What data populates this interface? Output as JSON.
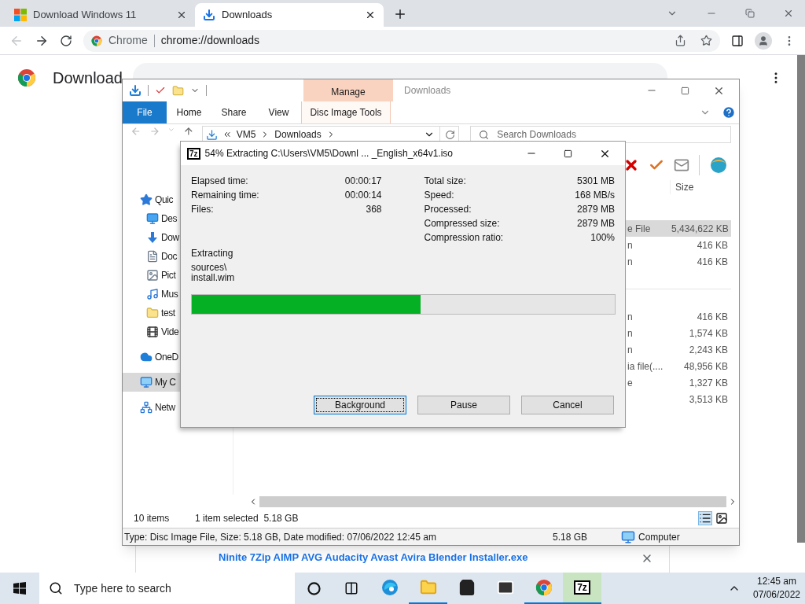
{
  "browser": {
    "tabs": [
      {
        "title": "Download Windows 11",
        "selected": false
      },
      {
        "title": "Downloads",
        "selected": true
      }
    ],
    "omnibox": {
      "site_label": "Chrome",
      "url": "chrome://downloads"
    },
    "page": {
      "title": "Download",
      "download": {
        "filename": "Ninite 7Zip AIMP AVG Audacity Avast Avira Blender Installer.exe"
      }
    }
  },
  "explorer": {
    "title": "Downloads",
    "contextual_header": "Manage",
    "ribbon_tabs": [
      {
        "label": "File",
        "kind": "file"
      },
      {
        "label": "Home",
        "kind": "tab"
      },
      {
        "label": "Share",
        "kind": "tab"
      },
      {
        "label": "View",
        "kind": "tab"
      },
      {
        "label": "Disc Image Tools",
        "kind": "contextual"
      }
    ],
    "breadcrumb": [
      "VM5",
      "Downloads"
    ],
    "search_placeholder": "Search Downloads",
    "column_header": "Size",
    "nav": [
      {
        "label": "Quic",
        "selected": false
      },
      {
        "label": "Des",
        "selected": false
      },
      {
        "label": "Dow",
        "selected": false
      },
      {
        "label": "Doc",
        "selected": false
      },
      {
        "label": "Pict",
        "selected": false
      },
      {
        "label": "Mus",
        "selected": false
      },
      {
        "label": "test",
        "selected": false
      },
      {
        "label": "Vide",
        "selected": false
      },
      {
        "label": "OneD",
        "selected": false
      },
      {
        "label": "My C",
        "selected": true
      },
      {
        "label": "Netw",
        "selected": false
      }
    ],
    "groups": [
      {
        "rows": [
          {
            "type": "e File",
            "size": "5,434,622 KB",
            "selected": true
          },
          {
            "type": "n",
            "size": "416 KB",
            "selected": false
          },
          {
            "type": "n",
            "size": "416 KB",
            "selected": false
          }
        ]
      },
      {
        "rows": [
          {
            "type": "n",
            "size": "416 KB",
            "selected": false
          },
          {
            "type": "n",
            "size": "1,574 KB",
            "selected": false
          },
          {
            "type": "n",
            "size": "2,243 KB",
            "selected": false
          },
          {
            "type": "ia file(....",
            "size": "48,956 KB",
            "selected": false
          },
          {
            "type": "e",
            "size": "1,327 KB",
            "selected": false
          },
          {
            "size": "3,513 KB",
            "selected": false
          }
        ]
      }
    ],
    "status": {
      "item_count": "10 items",
      "selection": "1 item selected  5.18 GB"
    },
    "details": {
      "info": "Type: Disc Image File, Size: 5.18 GB, Date modified: 07/06/2022 12:45 am",
      "size": "5.18 GB",
      "location": "Computer"
    }
  },
  "dialog": {
    "app_icon_text": "7z",
    "title": "54% Extracting C:\\Users\\VM5\\Downl ... _English_x64v1.iso",
    "left_stats": [
      {
        "label": "Elapsed time:",
        "value": "00:00:17"
      },
      {
        "label": "Remaining time:",
        "value": "00:00:14"
      },
      {
        "label": "Files:",
        "value": "368"
      }
    ],
    "right_stats": [
      {
        "label": "Total size:",
        "value": "5301 MB"
      },
      {
        "label": "Speed:",
        "value": "168 MB/s"
      },
      {
        "label": "Processed:",
        "value": "2879 MB"
      },
      {
        "label": "Compressed size:",
        "value": "2879 MB"
      },
      {
        "label": "Compression ratio:",
        "value": "100%"
      }
    ],
    "operation": "Extracting",
    "path_lines": [
      "sources\\",
      "install.wim"
    ],
    "progress": {
      "level": 0.54
    },
    "buttons": [
      {
        "label": "Background",
        "focused": true
      },
      {
        "label": "Pause",
        "focused": false
      },
      {
        "label": "Cancel",
        "focused": false
      }
    ]
  },
  "taskbar": {
    "search_placeholder": "Type here to search",
    "apps": [
      {
        "running": false,
        "active": false
      },
      {
        "running": true,
        "active": false
      },
      {
        "running": false,
        "active": false
      },
      {
        "running": false,
        "active": false
      },
      {
        "running": true,
        "active": false
      },
      {
        "label": "7z",
        "running": true,
        "active": true
      }
    ],
    "time": "12:45 am",
    "date": "07/06/2022"
  }
}
